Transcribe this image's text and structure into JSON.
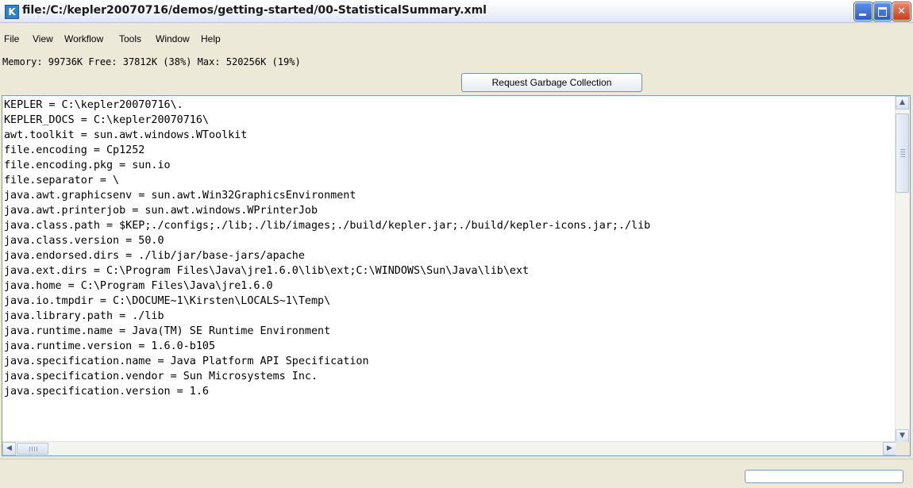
{
  "window": {
    "title": "file:/C:/kepler20070716/demos/getting-started/00-StatisticalSummary.xml",
    "app_icon_letter": "K",
    "close_glyph": "✕"
  },
  "menu": {
    "file": "File",
    "view": "View",
    "workflow": "Workflow",
    "tools": "Tools",
    "window": "Window",
    "help": "Help"
  },
  "memory_status": "Memory: 99736K Free: 37812K (38%) Max: 520256K (19%)",
  "gc_button_label": "Request Garbage Collection",
  "properties": [
    "KEPLER = C:\\kepler20070716\\.",
    "KEPLER_DOCS = C:\\kepler20070716\\",
    "awt.toolkit = sun.awt.windows.WToolkit",
    "file.encoding = Cp1252",
    "file.encoding.pkg = sun.io",
    "file.separator = \\",
    "java.awt.graphicsenv = sun.awt.Win32GraphicsEnvironment",
    "java.awt.printerjob = sun.awt.windows.WPrinterJob",
    "java.class.path = $KEP;./configs;./lib;./lib/images;./build/kepler.jar;./build/kepler-icons.jar;./lib",
    "java.class.version = 50.0",
    "java.endorsed.dirs = ./lib/jar/base-jars/apache",
    "java.ext.dirs = C:\\Program Files\\Java\\jre1.6.0\\lib\\ext;C:\\WINDOWS\\Sun\\Java\\lib\\ext",
    "java.home = C:\\Program Files\\Java\\jre1.6.0",
    "java.io.tmpdir = C:\\DOCUME~1\\Kirsten\\LOCALS~1\\Temp\\",
    "java.library.path = ./lib",
    "java.runtime.name = Java(TM) SE Runtime Environment",
    "java.runtime.version = 1.6.0-b105",
    "java.specification.name = Java Platform API Specification",
    "java.specification.vendor = Sun Microsystems Inc.",
    "java.specification.version = 1.6"
  ],
  "scroll": {
    "up": "▲",
    "down": "▼",
    "left": "◀",
    "right": "▶"
  },
  "status_text": ""
}
